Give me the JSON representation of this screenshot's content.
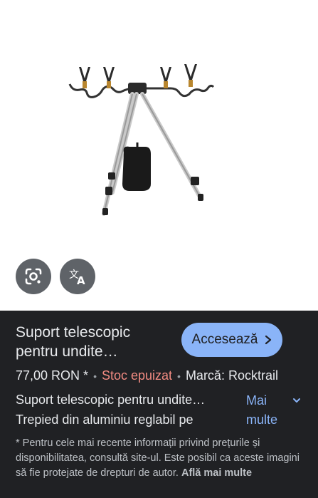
{
  "product": {
    "image_alt": "tripod-rod-holder-image",
    "title_line1": "Suport telescopic",
    "title_line2": "pentru undite…",
    "price": "77,00 RON *",
    "stock": "Stoc epuizat",
    "brand": "Marcă: Rocktrail",
    "description_line1": "Suport telescopic pentru undite…",
    "description_line2": "Trepied din aluminiu reglabil pe"
  },
  "actions": {
    "visit_label": "Accesează",
    "visit_icon": "chevron-right-icon",
    "more_line1": "Mai",
    "more_line2": "multe",
    "more_icon": "chevron-down-icon",
    "lens_icon": "google-lens-icon",
    "translate_icon": "translate-icon"
  },
  "disclaimer": {
    "text": "* Pentru cele mai recente informații privind prețurile și disponibilitatea, consultă site-ul. Este posibil ca aceste imagini să fie protejate de drepturi de autor.",
    "learn_more": "Află mai multe"
  },
  "colors": {
    "panel_bg": "#202124",
    "accent": "#8ab4f8",
    "stock_red": "#f28b82",
    "fab_bg": "#5f6368"
  }
}
